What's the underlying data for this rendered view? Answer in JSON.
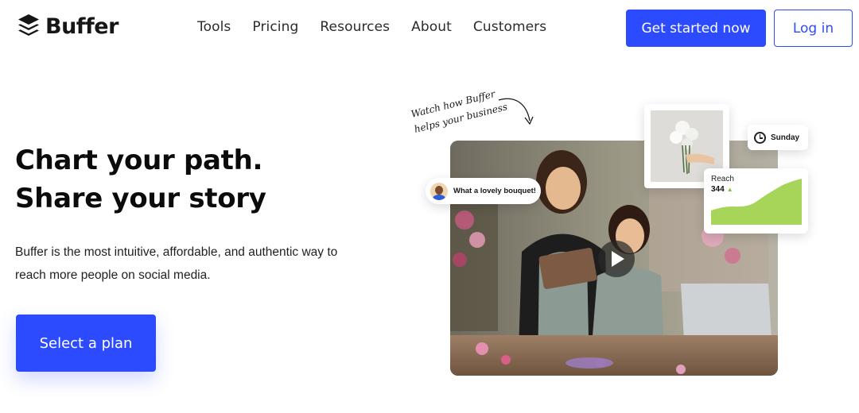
{
  "brand": {
    "name": "Buffer",
    "accent": "#2c4bff"
  },
  "nav": {
    "items": [
      {
        "label": "Tools"
      },
      {
        "label": "Pricing"
      },
      {
        "label": "Resources"
      },
      {
        "label": "About"
      },
      {
        "label": "Customers"
      }
    ]
  },
  "header": {
    "cta_label": "Get started now",
    "login_label": "Log in"
  },
  "hero": {
    "title_line1": "Chart your path.",
    "title_line2": "Share your story",
    "subtitle": "Buffer is the most intuitive, affordable, and authentic way to reach more people on social media.",
    "cta_label": "Select a plan"
  },
  "media": {
    "handnote_line1": "Watch how Buffer",
    "handnote_line2": "helps your business",
    "comment_text": "What a lovely bouquet!",
    "schedule_day": "Sunday",
    "reach_label": "Reach",
    "reach_value": "344",
    "reach_trend_color": "#a6d55a",
    "play_icon": "play-icon"
  }
}
